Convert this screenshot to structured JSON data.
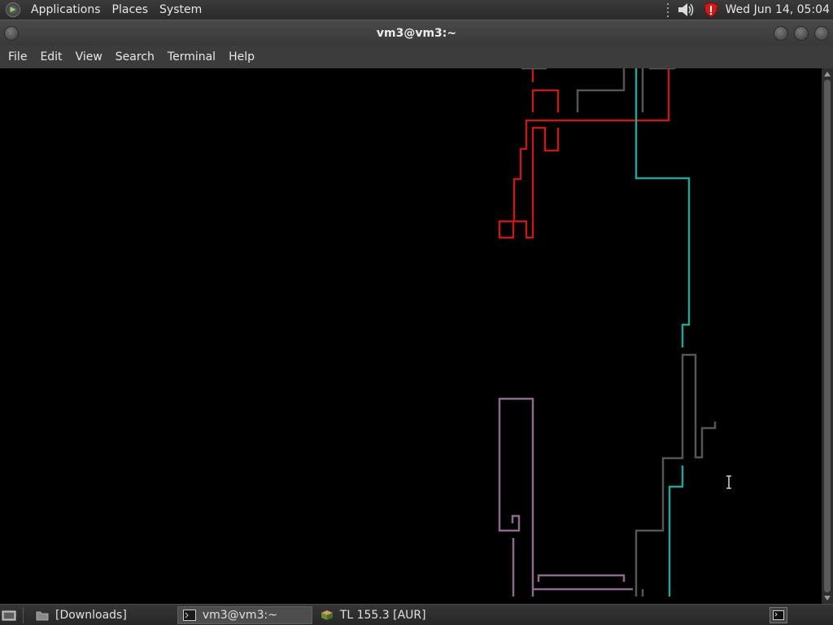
{
  "top_panel": {
    "menus": [
      "Applications",
      "Places",
      "System"
    ],
    "clock": "Wed Jun 14, 05:04",
    "icons": {
      "logo": "gnome-foot-icon",
      "speaker": "speaker-volume-icon",
      "shield": "red-shield-icon"
    }
  },
  "window": {
    "title": "vm3@vm3:~",
    "menus": [
      "File",
      "Edit",
      "View",
      "Search",
      "Terminal",
      "Help"
    ]
  },
  "terminal": {
    "background": "#000000",
    "pipe_colors": {
      "red": "#c01a1a",
      "teal": "#2aa198",
      "gray": "#555555",
      "purple": "#8a6b8a"
    }
  },
  "taskbar": {
    "tasks": [
      {
        "label": "[Downloads]",
        "icon": "folder-icon",
        "active": false
      },
      {
        "label": "vm3@vm3:~",
        "icon": "terminal-icon",
        "active": true
      },
      {
        "label": "TL 155.3 [AUR]",
        "icon": "cube-icon",
        "active": false
      }
    ]
  }
}
